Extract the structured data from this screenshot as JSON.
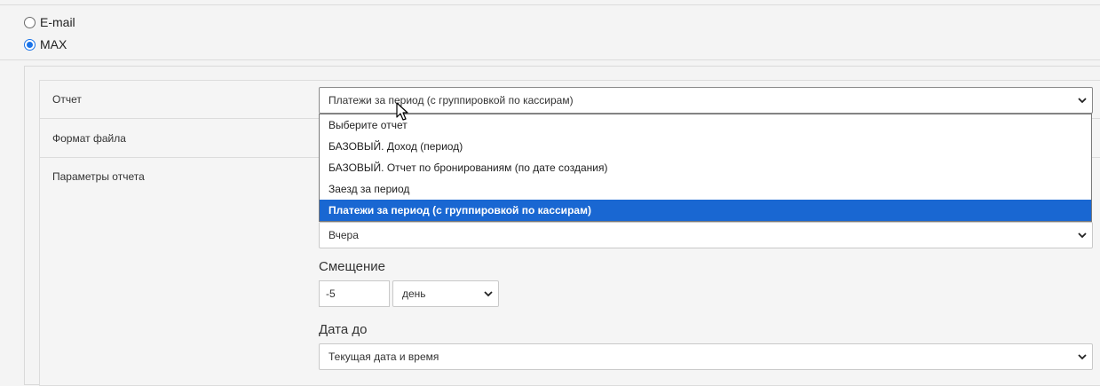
{
  "delivery": {
    "options": [
      {
        "label": "E-mail",
        "checked": false
      },
      {
        "label": "MAX",
        "checked": true
      }
    ]
  },
  "form": {
    "report_label": "Отчет",
    "report_selected": "Платежи за период (с группировкой по кассирам)",
    "format_label": "Формат файла",
    "params_label": "Параметры отчета"
  },
  "dropdown": {
    "options": [
      "Выберите отчет",
      "БАЗОВЫЙ. Доход (период)",
      "БАЗОВЫЙ. Отчет по бронированиям (по дате создания)",
      "Заезд за период",
      "Платежи за период (с группировкой по кассирам)"
    ],
    "selected_index": 4
  },
  "params": {
    "date_from_value": "Вчера",
    "offset_label": "Смещение",
    "offset_value": "-5",
    "offset_unit": "день",
    "date_to_label": "Дата до",
    "date_to_value": "Текущая дата и время"
  },
  "icons": {
    "chevron": "chevron-down-icon",
    "cursor": "mouse-pointer-icon"
  },
  "colors": {
    "accent": "#1967d2",
    "radio_checked": "#1a73e8"
  }
}
